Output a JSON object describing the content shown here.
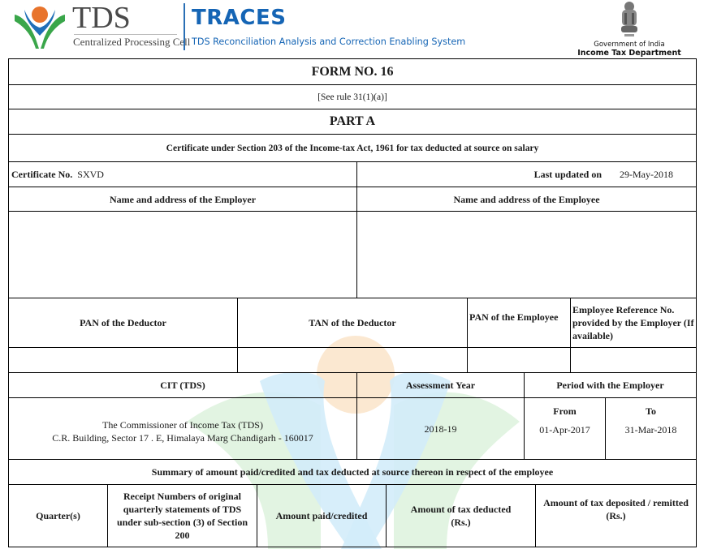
{
  "header": {
    "tds_brand": "TDS",
    "tds_subtitle": "Centralized Processing Cell",
    "traces_title": "TRACES",
    "traces_subtitle": "TDS Reconciliation Analysis and Correction Enabling System",
    "gov_line": "Government of India",
    "dept_line": "Income Tax Department"
  },
  "colors": {
    "traces_blue": "#1565b5",
    "logo_green": "#3aa64a",
    "logo_blue": "#1f6fb8",
    "logo_orange": "#e8742c"
  },
  "form": {
    "title": "FORM NO. 16",
    "rule": "[See rule 31(1)(a)]",
    "part": "PART A",
    "certificate_heading": "Certificate under Section 203 of the Income-tax Act, 1961 for tax deducted at source on salary",
    "certificate_no_label": "Certificate No.",
    "certificate_no_value": "SXVD",
    "last_updated_label": "Last updated on",
    "last_updated_value": "29-May-2018",
    "employer_name_label": "Name and address of the Employer",
    "employee_name_label": "Name and address of the Employee",
    "employer_name_value": "",
    "employee_name_value": "",
    "pan_deductor_label": "PAN of the Deductor",
    "tan_deductor_label": "TAN of the Deductor",
    "pan_employee_label": "PAN of the Employee",
    "employee_ref_label": "Employee Reference No. provided by the Employer (If available)",
    "pan_deductor_value": "",
    "tan_deductor_value": "",
    "pan_employee_value": "",
    "employee_ref_value": "",
    "cit_label": "CIT (TDS)",
    "assessment_year_label": "Assessment Year",
    "period_label": "Period with the Employer",
    "cit_value_line1": "The Commissioner of Income Tax (TDS)",
    "cit_value_line2": "C.R. Building, Sector 17 . E, Himalaya Marg Chandigarh - 160017",
    "assessment_year_value": "2018-19",
    "from_label": "From",
    "to_label": "To",
    "from_value": "01-Apr-2017",
    "to_value": "31-Mar-2018",
    "summary_heading": "Summary of amount paid/credited and tax deducted at source thereon in respect of the employee",
    "summary_columns": [
      "Quarter(s)",
      "Receipt Numbers of original quarterly statements of TDS under sub-section (3) of Section 200",
      "Amount paid/credited",
      "Amount of tax deducted (Rs.)",
      "Amount of tax deposited / remitted (Rs.)"
    ]
  }
}
